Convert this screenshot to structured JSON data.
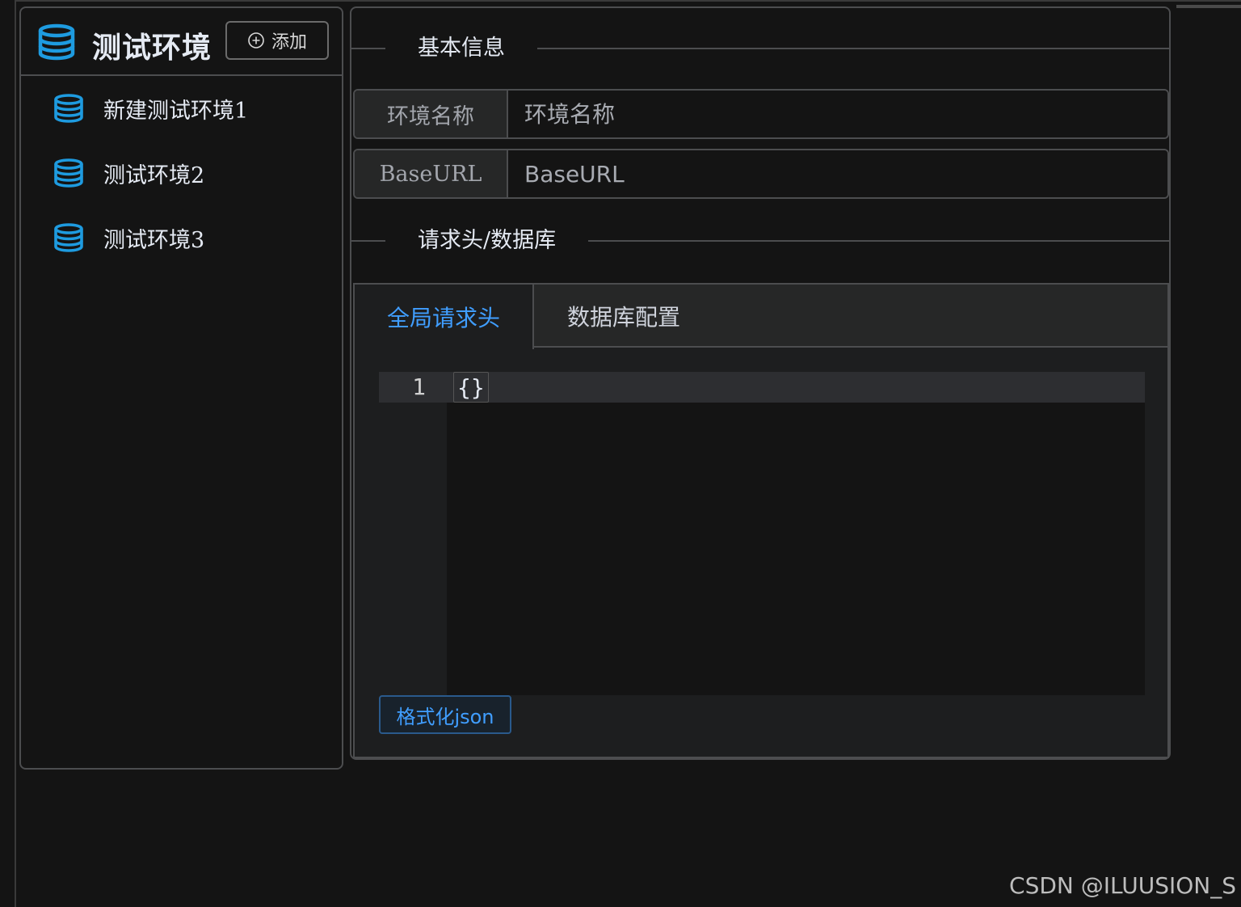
{
  "sidebar": {
    "title": "测试环境",
    "add_label": "添加",
    "items": [
      {
        "label": "新建测试环境1"
      },
      {
        "label": "测试环境2"
      },
      {
        "label": "测试环境3"
      }
    ]
  },
  "main": {
    "section_basic": "基本信息",
    "env_name": {
      "label": "环境名称",
      "placeholder": "环境名称",
      "value": ""
    },
    "base_url": {
      "label": "BaseURL",
      "placeholder": "BaseURL",
      "value": ""
    },
    "section_headers": "请求头/数据库",
    "tabs": [
      {
        "label": "全局请求头",
        "active": true
      },
      {
        "label": "数据库配置",
        "active": false
      }
    ],
    "editor": {
      "line_number": "1",
      "code": "{}"
    },
    "format_label": "格式化json"
  },
  "watermark": "CSDN @ILUUSION_S",
  "colors": {
    "accent": "#409eff",
    "icon": "#1e9be0",
    "background": "#141414"
  }
}
